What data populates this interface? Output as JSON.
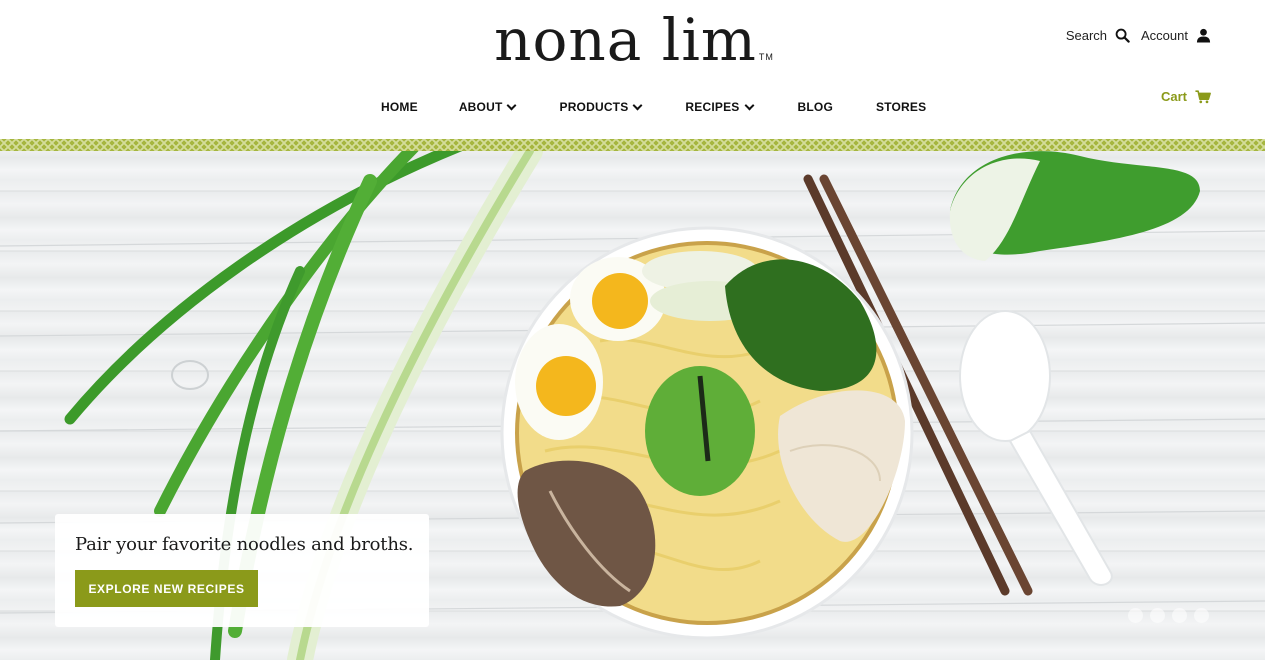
{
  "brand": {
    "logo_text": "nona lim",
    "trademark": "TM"
  },
  "header": {
    "search_label": "Search",
    "account_label": "Account",
    "cart_label": "Cart",
    "search_icon": "search-icon",
    "account_icon": "user-icon",
    "cart_icon": "cart-icon"
  },
  "nav": {
    "items": [
      {
        "label": "HOME",
        "dropdown": false
      },
      {
        "label": "ABOUT",
        "dropdown": true
      },
      {
        "label": "PRODUCTS",
        "dropdown": true
      },
      {
        "label": "RECIPES",
        "dropdown": true
      },
      {
        "label": "BLOG",
        "dropdown": false
      },
      {
        "label": "STORES",
        "dropdown": false
      }
    ]
  },
  "hero": {
    "promo_title": "Pair your favorite noodles and broths.",
    "promo_button": "EXPLORE NEW RECIPES",
    "slide_count": 4,
    "image_description": "ramen bowl with eggs, bok choy, spinach, mushrooms, chicken, chopsticks, spoon, scallions"
  },
  "colors": {
    "accent": "#8b9a1a",
    "band": "#a6b640",
    "text": "#111111"
  }
}
